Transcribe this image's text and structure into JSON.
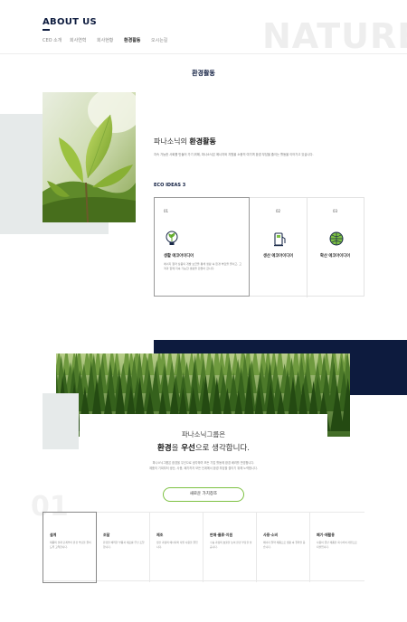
{
  "header": {
    "title": "ABOUT US",
    "watermark": "NATURE",
    "tabs": [
      {
        "label": "CEO 소개",
        "active": false
      },
      {
        "label": "회사연혁",
        "active": false
      },
      {
        "label": "회사현황",
        "active": false
      },
      {
        "label": "환경활동",
        "active": true
      },
      {
        "label": "오시는길",
        "active": false
      }
    ]
  },
  "section1": {
    "title": "환경활동",
    "intro_light": "파나소닉의",
    "intro_bold": "환경활동",
    "intro_body": "지속 가능한 사회를 만들어 가기 위해, 파나소닉은 에너지와 자원을 소중히 여기며 환경 부담을 줄이는 활동을 이어가고 있습니다.",
    "eco_label": "ECO IDEAS 3",
    "cards": [
      {
        "num": "01",
        "title": "생활 에코아이디어",
        "icon": "plant-bulb-icon",
        "desc": "에너지 절약 상품의 개발 보급을 통해 생활 속 환경 부담을 줄이고, 고객과 함께 지속 가능한 생활을 만들어 갑니다."
      },
      {
        "num": "02",
        "title": "생산 에코아이디어",
        "icon": "fuel-pump-icon"
      },
      {
        "num": "03",
        "title": "확산 에코아이디어",
        "icon": "globe-icon"
      }
    ]
  },
  "section2": {
    "line1": "파나소닉그룹은",
    "line2_bold1": "환경",
    "line2_mid": "을",
    "line2_bold2": "우선",
    "line2_end": "으로 생각합니다.",
    "para1": "파나소닉그룹은 환경을 우선으로 생각하며 모든 기업 활동에 환경 배려를 반영합니다.",
    "para2": "제품의 기획부터 생산, 사용, 폐기까지 모든 단계에서 환경 부담을 줄이기 위해 노력합니다.",
    "button": "새로운 가치창조",
    "big_num": "01"
  },
  "steps": [
    {
      "title": "설계",
      "desc": "제품의 설계 단계부터 환경 부담을 줄이도록 고려합니다."
    },
    {
      "title": "조달",
      "desc": "환경을 배려한 부품과 재료를 우선 조달합니다."
    },
    {
      "title": "제조",
      "desc": "생산 과정의 에너지와 자원 사용을 줄입니다."
    },
    {
      "title": "판매·물류·지원",
      "desc": "수송 과정의 효율을 높여 환경 부담을 낮춥니다."
    },
    {
      "title": "사용·소비",
      "desc": "에너지 절약 제품으로 생활 속 절약을 돕습니다."
    },
    {
      "title": "폐기·재활용",
      "desc": "사용이 끝난 제품을 회수하여 자원으로 되살립니다."
    }
  ]
}
